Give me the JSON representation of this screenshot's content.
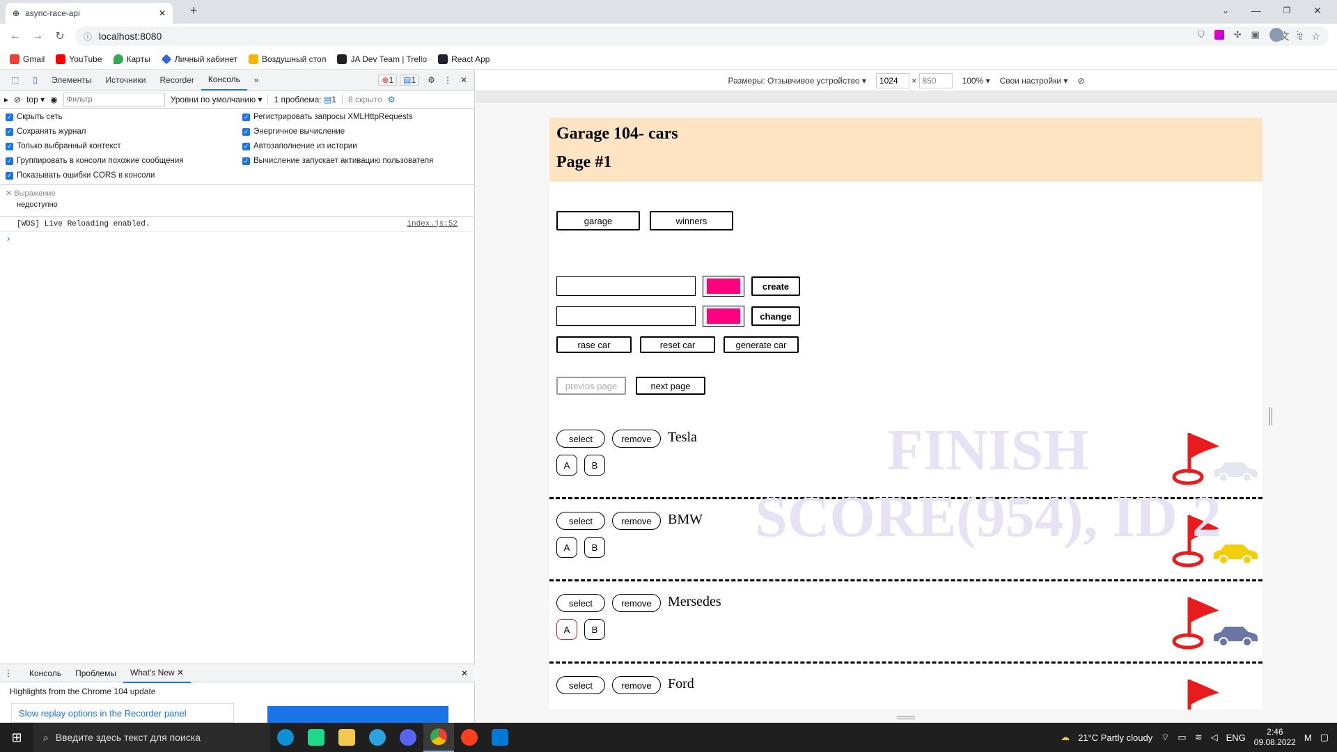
{
  "browser": {
    "tab_title": "async-race-api",
    "url": "localhost:8080",
    "bookmarks": [
      "Gmail",
      "YouTube",
      "Карты",
      "Личный кабинет",
      "Воздушный стол",
      "JA Dev Team | Trello",
      "React App"
    ]
  },
  "devtools": {
    "tabs": [
      "Элементы",
      "Источники",
      "Recorder",
      "Консоль"
    ],
    "error_count": "1",
    "message_count": "1",
    "toolbar": {
      "context": "top",
      "filter_placeholder": "Фильтр",
      "levels": "Уровни по умолчанию",
      "issues": "1 проблема:",
      "issues_count": "1",
      "hidden": "8 скрыто"
    },
    "settings_left": [
      "Скрыть сеть",
      "Сохранять журнал",
      "Только выбранный контекст",
      "Группировать в консоли похожие сообщения",
      "Показывать ошибки CORS в консоли"
    ],
    "settings_right": [
      "Регистрировать запросы XMLHttpRequests",
      "Энергичное вычисление",
      "Автозаполнение из истории",
      "Вычисление запускает активацию пользователя"
    ],
    "expression_label": "Выражение",
    "expression_value": "недоступно",
    "log_message": "[WDS] Live Reloading enabled.",
    "log_source": "index.js:52",
    "drawer_tabs": [
      "Консоль",
      "Проблемы",
      "What's New"
    ],
    "drawer_headline": "Highlights from the Chrome 104 update",
    "drawer_link": "Slow replay options in the Recorder panel"
  },
  "device_toolbar": {
    "dimensions_label": "Размеры: Отзывчивое устройство",
    "width": "1024",
    "height": "850",
    "zoom": "100%",
    "throttle": "Свои настройки"
  },
  "app": {
    "title": "Garage 104- cars",
    "page": "Page #1",
    "nav": {
      "garage": "garage",
      "winners": "winners"
    },
    "create_label": "create",
    "change_label": "change",
    "race_label": "rase car",
    "reset_label": "reset car",
    "generate_label": "generate car",
    "prev_label": "previos page",
    "next_label": "next page",
    "watermark_line1": "FINISH",
    "watermark_line2": "SCORE(954), ID 2",
    "select_label": "select",
    "remove_label": "remove",
    "a_label": "A",
    "b_label": "B",
    "input_color": "#ff007f",
    "cars": [
      {
        "name": "Tesla",
        "color": "#e5e7ee"
      },
      {
        "name": "BMW",
        "color": "#f2cf0a"
      },
      {
        "name": "Mersedes",
        "color": "#6a76a3"
      },
      {
        "name": "Ford",
        "color": "#ff2020"
      }
    ]
  },
  "taskbar": {
    "search_placeholder": "Введите здесь текст для поиска",
    "weather": "21°C  Partly cloudy",
    "lang": "ENG",
    "time": "2:46",
    "date": "09.08.2022"
  }
}
